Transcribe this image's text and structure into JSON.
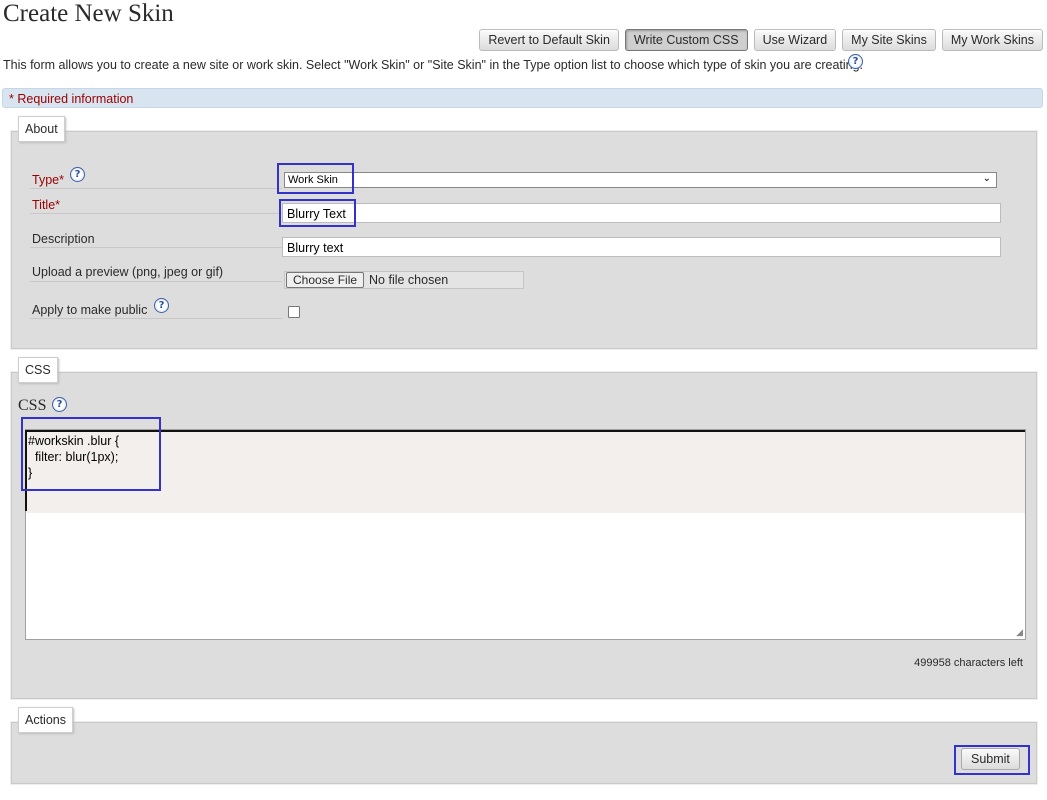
{
  "page": {
    "title": "Create New Skin",
    "intro": "This form allows you to create a new site or work skin. Select \"Work Skin\" or \"Site Skin\" in the Type option list to choose which type of skin you are creating.",
    "help_glyph": "?"
  },
  "nav": {
    "revert": "Revert to Default Skin",
    "custom_css": "Write Custom CSS",
    "wizard": "Use Wizard",
    "site_skins": "My Site Skins",
    "work_skins": "My Work Skins"
  },
  "required_notice": "* Required information",
  "about": {
    "legend": "About",
    "type_label": "Type*",
    "type_value": "Work Skin",
    "title_label": "Title*",
    "title_value": "Blurry Text",
    "description_label": "Description",
    "description_value": "Blurry text",
    "preview_label": "Upload a preview (png, jpeg or gif)",
    "file_button": "Choose File",
    "file_status": "No file chosen",
    "public_label": "Apply to make public",
    "public_checked": false
  },
  "css": {
    "legend": "CSS",
    "heading": "CSS",
    "code": "#workskin .blur {\n  filter: blur(1px);\n}",
    "chars_left": "499958 characters left"
  },
  "actions": {
    "legend": "Actions",
    "submit": "Submit"
  },
  "colors": {
    "highlight": "#3333cc",
    "required_text": "#990000",
    "required_bar": "#d8e5f1",
    "fieldset_bg": "#dddddd"
  }
}
